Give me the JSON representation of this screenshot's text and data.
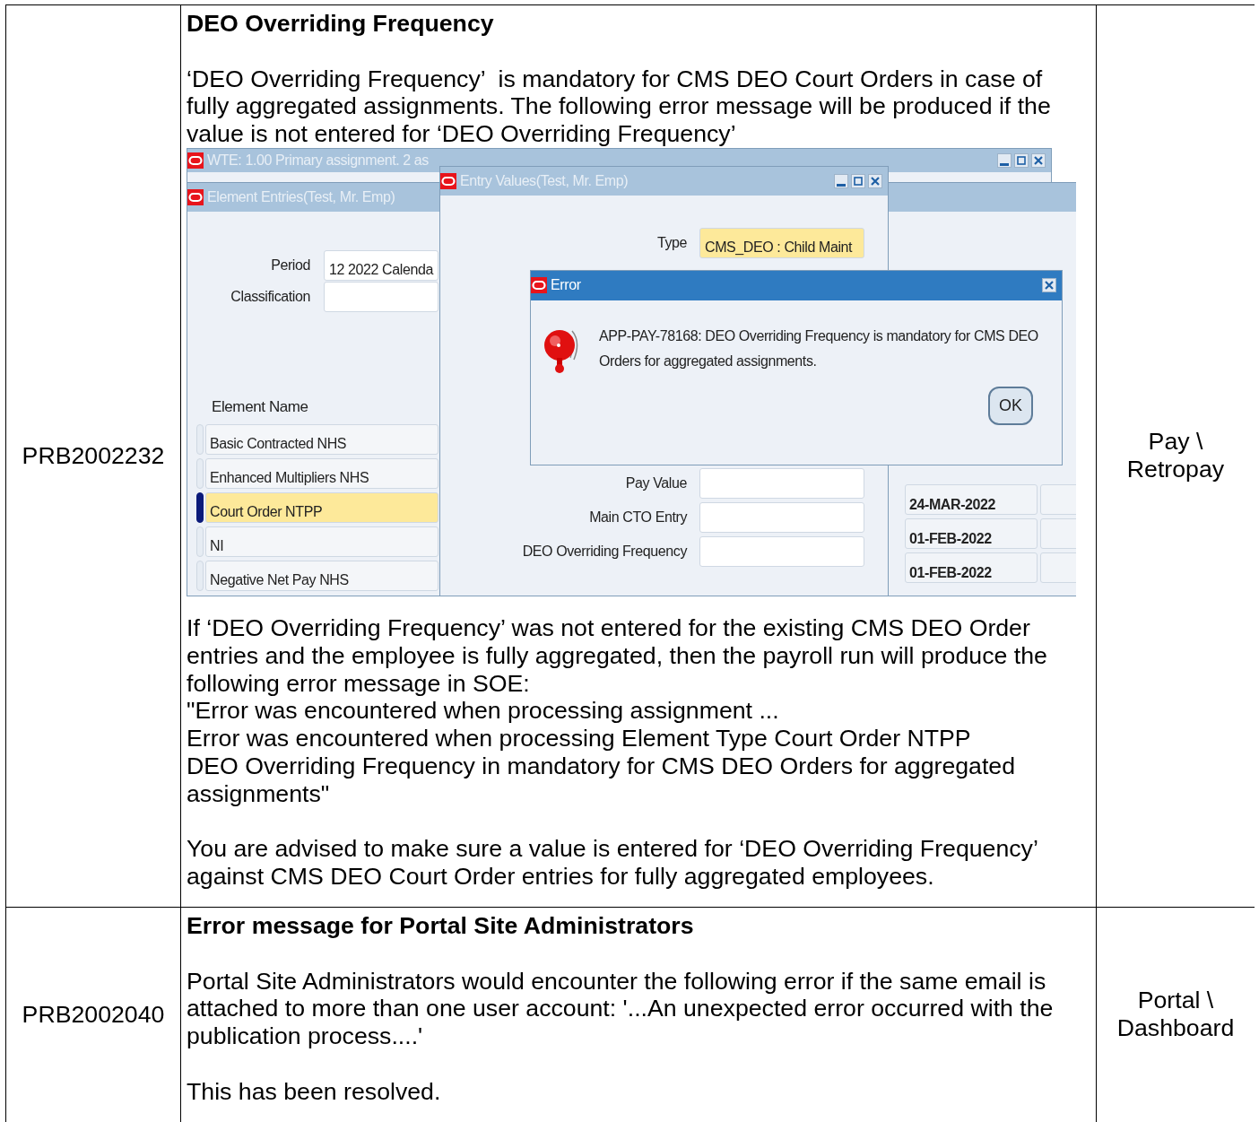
{
  "table": {
    "rows": [
      {
        "id": "PRB2002232",
        "area": "Pay \\ Retropay",
        "content": [
          {
            "kind": "heading",
            "text": "DEO Overriding Frequency"
          },
          {
            "kind": "text",
            "lines": [
              "‘DEO Overriding Frequency’  is mandatory for CMS DEO Court Orders in case of fully aggregated assignments. The following error message will be produced if the value is not entered for ‘DEO Overriding Frequency’"
            ]
          },
          {
            "kind": "screenshot",
            "windows": [
              {
                "kind": "main",
                "title": "WTE:  1.00 Primary assignment. 2 as",
                "active": false
              },
              {
                "kind": "entries",
                "title": "Element Entries(Test, Mr. Emp)",
                "active": false,
                "fields": [
                  {
                    "label": "Period",
                    "value": "12 2022 Calenda"
                  },
                  {
                    "label": "Classification"
                  }
                ],
                "list_header": "Element Name",
                "rows": [
                  {
                    "name": "Basic Contracted NHS",
                    "selected": false
                  },
                  {
                    "name": "Enhanced Multipliers NHS",
                    "selected": false
                  },
                  {
                    "name": "Court Order NTPP",
                    "selected": true
                  },
                  {
                    "name": "NI",
                    "selected": false
                  },
                  {
                    "name": "Negative Net Pay NHS",
                    "selected": false
                  }
                ],
                "dates": [
                  "24-MAR-2022",
                  "01-FEB-2022",
                  "01-FEB-2022"
                ]
              },
              {
                "kind": "entry_values",
                "title": "Entry Values(Test, Mr. Emp)",
                "active": false,
                "fields": [
                  {
                    "label": "Type",
                    "value": "CMS_DEO : Child Maint",
                    "highlighted": true
                  },
                  {
                    "label": "Pay Value",
                    "highlighted": false
                  },
                  {
                    "label": "Main CTO Entry",
                    "highlighted": false
                  },
                  {
                    "label": "DEO Overriding Frequency",
                    "highlighted": false
                  }
                ]
              },
              {
                "kind": "dialog",
                "title": "Error",
                "active": true,
                "message": "APP-PAY-78168: DEO Overriding Frequency is mandatory for CMS DEO Orders for aggregated assignments.",
                "button": "OK"
              }
            ]
          },
          {
            "kind": "text",
            "lines": [
              "If ‘DEO Overriding Frequency’ was not entered for the existing CMS DEO Order entries and the employee is fully aggregated, then the payroll run will produce the following error message in SOE:",
              "\"Error was encountered when processing assignment ...",
              "Error was encountered when processing Element Type Court Order NTPP",
              "DEO Overriding Frequency in mandatory for CMS DEO Orders for aggregated assignments\""
            ]
          },
          {
            "kind": "text",
            "lines": [
              "You are advised to make sure a value is entered for ‘DEO Overriding Frequency’ against CMS DEO Court Order entries for fully aggregated employees."
            ]
          }
        ]
      },
      {
        "id": "PRB2002040",
        "area": "Portal \\ Dashboard",
        "content": [
          {
            "kind": "heading",
            "text": "Error message for Portal Site Administrators"
          },
          {
            "kind": "text",
            "lines": [
              "Portal Site Administrators would encounter the following error if the same email is attached to more than one user account: '...An unexpected error occurred with the publication process....'"
            ]
          },
          {
            "kind": "text",
            "lines": [
              "This has been resolved."
            ]
          }
        ]
      }
    ]
  }
}
